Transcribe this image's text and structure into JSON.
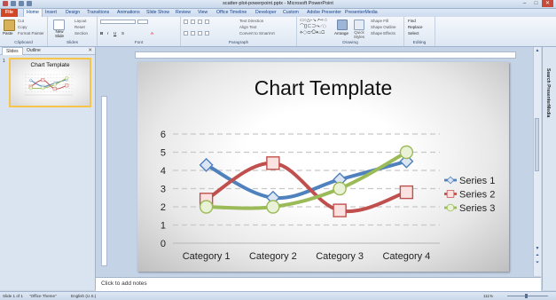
{
  "window": {
    "title": "scatter-plot-powerpoint.pptx - Microsoft PowerPoint"
  },
  "ribbon_tabs": [
    "File",
    "Home",
    "Insert",
    "Design",
    "Transitions",
    "Animations",
    "Slide Show",
    "Review",
    "View",
    "Office Timeline",
    "Developer",
    "Custom",
    "Adobe Presenter",
    "PresenterMedia"
  ],
  "ribbon": {
    "clipboard": {
      "label": "Clipboard",
      "paste": "Paste",
      "cut": "Cut",
      "copy": "Copy",
      "format_painter": "Format Painter"
    },
    "slides": {
      "label": "Slides",
      "new_slide": "New Slide",
      "layout": "Layout",
      "reset": "Reset",
      "section": "Section"
    },
    "font": {
      "label": "Font"
    },
    "paragraph": {
      "label": "Paragraph",
      "text_direction": "Text Direction",
      "align_text": "Align Text",
      "convert": "Convert to SmartArt"
    },
    "drawing": {
      "label": "Drawing",
      "arrange": "Arrange",
      "quick_styles": "Quick Styles",
      "shape_fill": "Shape Fill",
      "shape_outline": "Shape Outline",
      "shape_effects": "Shape Effects"
    },
    "editing": {
      "label": "Editing",
      "find": "Find",
      "replace": "Replace",
      "select": "Select"
    }
  },
  "left_panel": {
    "tabs": [
      "Slides",
      "Outline"
    ],
    "slide_number": "1",
    "thumb_title": "Chart Template"
  },
  "slide": {
    "title": "Chart Template"
  },
  "chart_data": {
    "type": "line",
    "categories": [
      "Category 1",
      "Category 2",
      "Category 3",
      "Category 4"
    ],
    "series": [
      {
        "name": "Series 1",
        "values": [
          4.3,
          2.5,
          3.5,
          4.5
        ],
        "color": "#4f81bd",
        "marker": "diamond"
      },
      {
        "name": "Series 2",
        "values": [
          2.4,
          4.4,
          1.8,
          2.8
        ],
        "color": "#c0504d",
        "marker": "square"
      },
      {
        "name": "Series 3",
        "values": [
          2.0,
          2.0,
          3.0,
          5.0
        ],
        "color": "#9bbb59",
        "marker": "circle"
      }
    ],
    "yticks": [
      0,
      1,
      2,
      3,
      4,
      5,
      6
    ],
    "ylim": [
      0,
      6
    ],
    "gridlines": "dashed",
    "legend": "right"
  },
  "notes": {
    "placeholder": "Click to add notes"
  },
  "right_pane": {
    "label": "Search PresenterMedia"
  },
  "status": {
    "slide": "Slide 1 of 1",
    "theme": "\"Office Theme\"",
    "language": "English (U.S.)",
    "zoom": "111%"
  }
}
